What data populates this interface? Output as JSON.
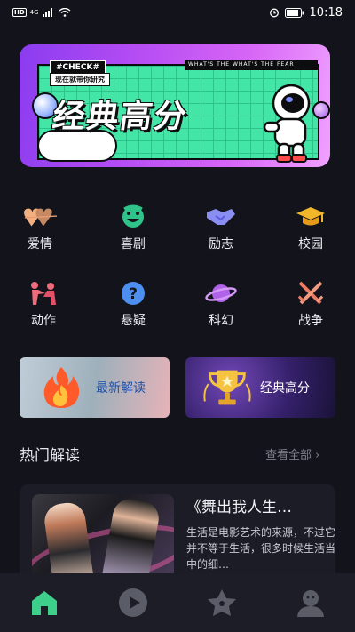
{
  "status_bar": {
    "left_badges": [
      "HD",
      "4G"
    ],
    "time": "10:18",
    "icons": [
      "signal-icon",
      "wifi-icon",
      "alarm-icon",
      "battery-icon"
    ]
  },
  "banner": {
    "check_tag": "#CHECK#",
    "subtitle": "现在就带你研究",
    "tagline": "WHAT'S THE WHAT'S THE FEAR",
    "title": "经典高分"
  },
  "categories": [
    {
      "label": "爱情",
      "icon": "hearts-icon",
      "color": "#e8a27a"
    },
    {
      "label": "喜剧",
      "icon": "smile-face-icon",
      "color": "#2fc38a"
    },
    {
      "label": "励志",
      "icon": "handshake-icon",
      "color": "#8a8ef2"
    },
    {
      "label": "校园",
      "icon": "graduation-cap-icon",
      "color": "#f2b62a"
    },
    {
      "label": "动作",
      "icon": "fighting-icon",
      "color": "#ef6a7a"
    },
    {
      "label": "悬疑",
      "icon": "question-icon",
      "color": "#4c8ff0"
    },
    {
      "label": "科幻",
      "icon": "planet-icon",
      "color": "#b062e8"
    },
    {
      "label": "战争",
      "icon": "crossed-swords-icon",
      "color": "#ef7a62"
    }
  ],
  "feature_cards": {
    "latest": {
      "label": "最新解读",
      "icon": "flame-icon"
    },
    "classic": {
      "label": "经典高分",
      "icon": "trophy-icon"
    }
  },
  "section": {
    "title": "热门解读",
    "see_all": "查看全部 ›"
  },
  "hot_list": [
    {
      "title": "《舞出我人生…",
      "description": "生活是电影艺术的来源，不过它并不等于生活，很多时候生活当中的细…"
    }
  ],
  "bottom_nav": [
    {
      "name": "home",
      "icon": "home-icon",
      "active": true
    },
    {
      "name": "play",
      "icon": "play-icon",
      "active": false
    },
    {
      "name": "favorites",
      "icon": "star-icon",
      "active": false
    },
    {
      "name": "profile",
      "icon": "user-icon",
      "active": false
    }
  ],
  "colors": {
    "background": "#13141b",
    "nav_active": "#3ed08a",
    "nav_inactive": "#5a5c67"
  }
}
